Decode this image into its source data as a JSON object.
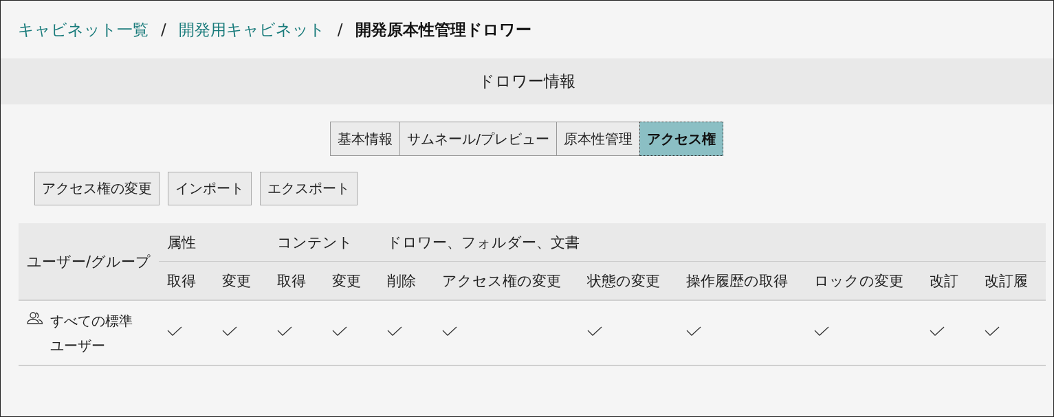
{
  "breadcrumb": [
    {
      "label": "キャビネット一覧",
      "kind": "link"
    },
    {
      "label": "/",
      "kind": "separator"
    },
    {
      "label": "開発用キャビネット",
      "kind": "link"
    },
    {
      "label": "/",
      "kind": "separator"
    },
    {
      "label": "開発原本性管理ドロワー",
      "kind": "current"
    }
  ],
  "section_title": "ドロワー情報",
  "tabs": [
    {
      "label": "基本情報",
      "selected": false
    },
    {
      "label": "サムネール/プレビュー",
      "selected": false
    },
    {
      "label": "原本性管理",
      "selected": false
    },
    {
      "label": "アクセス権",
      "selected": true
    }
  ],
  "buttons": [
    "アクセス権の変更",
    "インポート",
    "エクスポート"
  ],
  "table": {
    "first_column": "ユーザー/グループ",
    "groups": [
      {
        "label": "属性",
        "columns": [
          "取得",
          "変更"
        ]
      },
      {
        "label": "コンテント",
        "columns": [
          "取得",
          "変更"
        ]
      },
      {
        "label": "ドロワー、フォルダー、文書",
        "columns": [
          "削除",
          "アクセス権の変更",
          "状態の変更",
          "操作履歴の取得",
          "ロックの変更",
          "改訂",
          "改訂履"
        ]
      }
    ],
    "rows": [
      {
        "name": "すべての標準ユーザー",
        "kind": "group",
        "checked": [
          true,
          true,
          true,
          true,
          true,
          true,
          true,
          true,
          true,
          true,
          true
        ]
      }
    ]
  }
}
